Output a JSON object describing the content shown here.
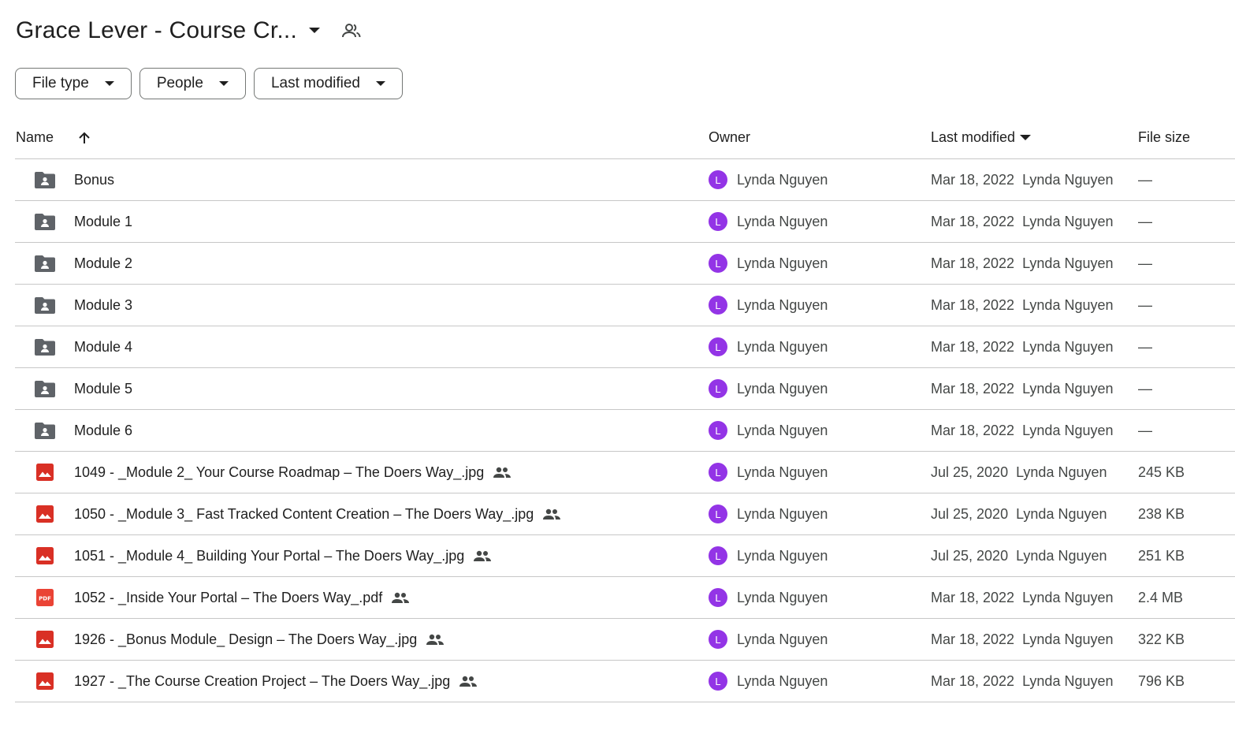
{
  "header": {
    "title": "Grace Lever - Course Cr..."
  },
  "filters": [
    {
      "label": "File type"
    },
    {
      "label": "People"
    },
    {
      "label": "Last modified"
    }
  ],
  "columns": {
    "name": "Name",
    "owner": "Owner",
    "last_modified": "Last modified",
    "file_size": "File size"
  },
  "colors": {
    "avatar": "#9334e6",
    "folder": "#5f6368",
    "image": "#d93025",
    "pdf": "#ea4335"
  },
  "rows": [
    {
      "icon": "folder-shared-icon",
      "name": "Bonus",
      "shared": false,
      "owner_initial": "L",
      "owner": "Lynda Nguyen",
      "modified_date": "Mar 18, 2022",
      "modified_by": "Lynda Nguyen",
      "size": "—"
    },
    {
      "icon": "folder-shared-icon",
      "name": "Module 1",
      "shared": false,
      "owner_initial": "L",
      "owner": "Lynda Nguyen",
      "modified_date": "Mar 18, 2022",
      "modified_by": "Lynda Nguyen",
      "size": "—"
    },
    {
      "icon": "folder-shared-icon",
      "name": "Module 2",
      "shared": false,
      "owner_initial": "L",
      "owner": "Lynda Nguyen",
      "modified_date": "Mar 18, 2022",
      "modified_by": "Lynda Nguyen",
      "size": "—"
    },
    {
      "icon": "folder-shared-icon",
      "name": "Module 3",
      "shared": false,
      "owner_initial": "L",
      "owner": "Lynda Nguyen",
      "modified_date": "Mar 18, 2022",
      "modified_by": "Lynda Nguyen",
      "size": "—"
    },
    {
      "icon": "folder-shared-icon",
      "name": "Module 4",
      "shared": false,
      "owner_initial": "L",
      "owner": "Lynda Nguyen",
      "modified_date": "Mar 18, 2022",
      "modified_by": "Lynda Nguyen",
      "size": "—"
    },
    {
      "icon": "folder-shared-icon",
      "name": "Module 5",
      "shared": false,
      "owner_initial": "L",
      "owner": "Lynda Nguyen",
      "modified_date": "Mar 18, 2022",
      "modified_by": "Lynda Nguyen",
      "size": "—"
    },
    {
      "icon": "folder-shared-icon",
      "name": "Module 6",
      "shared": false,
      "owner_initial": "L",
      "owner": "Lynda Nguyen",
      "modified_date": "Mar 18, 2022",
      "modified_by": "Lynda Nguyen",
      "size": "—"
    },
    {
      "icon": "image-icon",
      "name": "1049 - _Module 2_ Your Course Roadmap – The Doers Way_.jpg",
      "shared": true,
      "owner_initial": "L",
      "owner": "Lynda Nguyen",
      "modified_date": "Jul 25, 2020",
      "modified_by": "Lynda Nguyen",
      "size": "245 KB"
    },
    {
      "icon": "image-icon",
      "name": "1050 - _Module 3_ Fast Tracked Content Creation – The Doers Way_.jpg",
      "shared": true,
      "owner_initial": "L",
      "owner": "Lynda Nguyen",
      "modified_date": "Jul 25, 2020",
      "modified_by": "Lynda Nguyen",
      "size": "238 KB"
    },
    {
      "icon": "image-icon",
      "name": "1051 - _Module 4_ Building Your Portal – The Doers Way_.jpg",
      "shared": true,
      "owner_initial": "L",
      "owner": "Lynda Nguyen",
      "modified_date": "Jul 25, 2020",
      "modified_by": "Lynda Nguyen",
      "size": "251 KB"
    },
    {
      "icon": "pdf-icon",
      "name": "1052 - _Inside Your Portal – The Doers Way_.pdf",
      "shared": true,
      "owner_initial": "L",
      "owner": "Lynda Nguyen",
      "modified_date": "Mar 18, 2022",
      "modified_by": "Lynda Nguyen",
      "size": "2.4 MB"
    },
    {
      "icon": "image-icon",
      "name": "1926 - _Bonus Module_ Design – The Doers Way_.jpg",
      "shared": true,
      "owner_initial": "L",
      "owner": "Lynda Nguyen",
      "modified_date": "Mar 18, 2022",
      "modified_by": "Lynda Nguyen",
      "size": "322 KB"
    },
    {
      "icon": "image-icon",
      "name": "1927 - _The Course Creation Project – The Doers Way_.jpg",
      "shared": true,
      "owner_initial": "L",
      "owner": "Lynda Nguyen",
      "modified_date": "Mar 18, 2022",
      "modified_by": "Lynda Nguyen",
      "size": "796 KB"
    }
  ]
}
